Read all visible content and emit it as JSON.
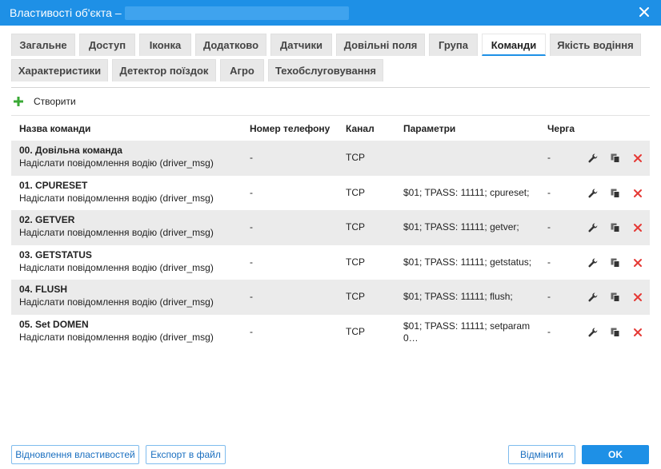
{
  "dialog": {
    "title": "Властивості об'єкта –",
    "close_icon": "close-icon"
  },
  "tabs": [
    {
      "label": "Загальне"
    },
    {
      "label": "Доступ"
    },
    {
      "label": "Іконка"
    },
    {
      "label": "Додатково"
    },
    {
      "label": "Датчики"
    },
    {
      "label": "Довільні поля"
    },
    {
      "label": "Група"
    },
    {
      "label": "Команди",
      "active": true
    },
    {
      "label": "Якість водіння"
    },
    {
      "label": "Характеристики"
    },
    {
      "label": "Детектор поїздок"
    },
    {
      "label": "Агро"
    },
    {
      "label": "Техобслуговування"
    }
  ],
  "toolbar": {
    "create_label": "Створити",
    "create_icon": "plus-icon",
    "accent_color": "#3aa935"
  },
  "table": {
    "columns": [
      "Назва команди",
      "Номер телефону",
      "Канал",
      "Параметри",
      "Черга"
    ],
    "rows": [
      {
        "name": "00. Довільна команда",
        "description": "Надіслати повідомлення водію (driver_msg)",
        "phone": "-",
        "channel": "TCP",
        "params": "",
        "queue": "-"
      },
      {
        "name": "01. CPURESET",
        "description": "Надіслати повідомлення водію (driver_msg)",
        "phone": "-",
        "channel": "TCP",
        "params": "$01; TPASS: 11111; cpureset;",
        "queue": "-"
      },
      {
        "name": "02. GETVER",
        "description": "Надіслати повідомлення водію (driver_msg)",
        "phone": "-",
        "channel": "TCP",
        "params": "$01; TPASS: 11111; getver;",
        "queue": "-"
      },
      {
        "name": "03. GETSTATUS",
        "description": "Надіслати повідомлення водію (driver_msg)",
        "phone": "-",
        "channel": "TCP",
        "params": "$01; TPASS: 11111; getstatus;",
        "queue": "-"
      },
      {
        "name": "04. FLUSH",
        "description": "Надіслати повідомлення водію (driver_msg)",
        "phone": "-",
        "channel": "TCP",
        "params": "$01; TPASS: 11111; flush;",
        "queue": "-"
      },
      {
        "name": "05. Set DOMEN",
        "description": "Надіслати повідомлення водію (driver_msg)",
        "phone": "-",
        "channel": "TCP",
        "params": "$01; TPASS: 11111; setparam 0…",
        "queue": "-"
      }
    ],
    "row_actions": [
      "wrench-icon",
      "copy-icon",
      "delete-icon"
    ],
    "delete_color": "#e53935"
  },
  "footer": {
    "restore_label": "Відновлення властивостей",
    "export_label": "Експорт в файл",
    "cancel_label": "Відмінити",
    "ok_label": "OK"
  }
}
